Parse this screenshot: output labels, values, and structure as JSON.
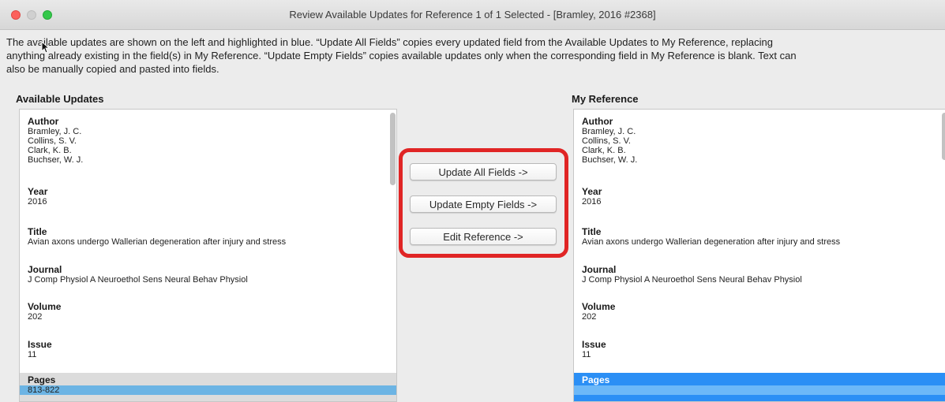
{
  "window": {
    "title": "Review Available Updates for Reference 1 of 1 Selected - [Bramley, 2016 #2368]"
  },
  "description": {
    "line1": "The available updates are shown on the left and highlighted in blue. “Update All Fields” copies every updated field from the Available Updates to My Reference, replacing",
    "line2": "anything already existing in the field(s) in My Reference. “Update Empty Fields” copies available updates only when the corresponding field in My Reference is blank. Text can",
    "line3": "also be manually copied and pasted into fields."
  },
  "available": {
    "heading": "Available Updates",
    "author_label": "Author",
    "authors": [
      "Bramley, J. C.",
      "Collins, S. V.",
      "Clark, K. B.",
      "Buchser, W. J."
    ],
    "year_label": "Year",
    "year": "2016",
    "title_label": "Title",
    "title": "Avian axons undergo Wallerian degeneration after injury and stress",
    "journal_label": "Journal",
    "journal": "J Comp Physiol A Neuroethol Sens Neural Behav Physiol",
    "volume_label": "Volume",
    "volume": "202",
    "issue_label": "Issue",
    "issue": "11",
    "pages_label": "Pages",
    "pages": "813-822"
  },
  "mine": {
    "heading": "My Reference",
    "author_label": "Author",
    "authors": [
      "Bramley, J. C.",
      "Collins, S. V.",
      "Clark, K. B.",
      "Buchser, W. J."
    ],
    "year_label": "Year",
    "year": "2016",
    "title_label": "Title",
    "title": "Avian axons undergo Wallerian degeneration after injury and stress",
    "journal_label": "Journal",
    "journal": "J Comp Physiol A Neuroethol Sens Neural Behav Physiol",
    "volume_label": "Volume",
    "volume": "202",
    "issue_label": "Issue",
    "issue": "11",
    "pages_label": "Pages",
    "pages": ""
  },
  "buttons": {
    "update_all": "Update All Fields ->",
    "update_empty": "Update Empty Fields ->",
    "edit_reference": "Edit Reference ->"
  },
  "colors": {
    "highlight_box": "#e02525",
    "available_update_bg": "#6cb4e4",
    "selected_field_bg": "#2b8ff5"
  }
}
